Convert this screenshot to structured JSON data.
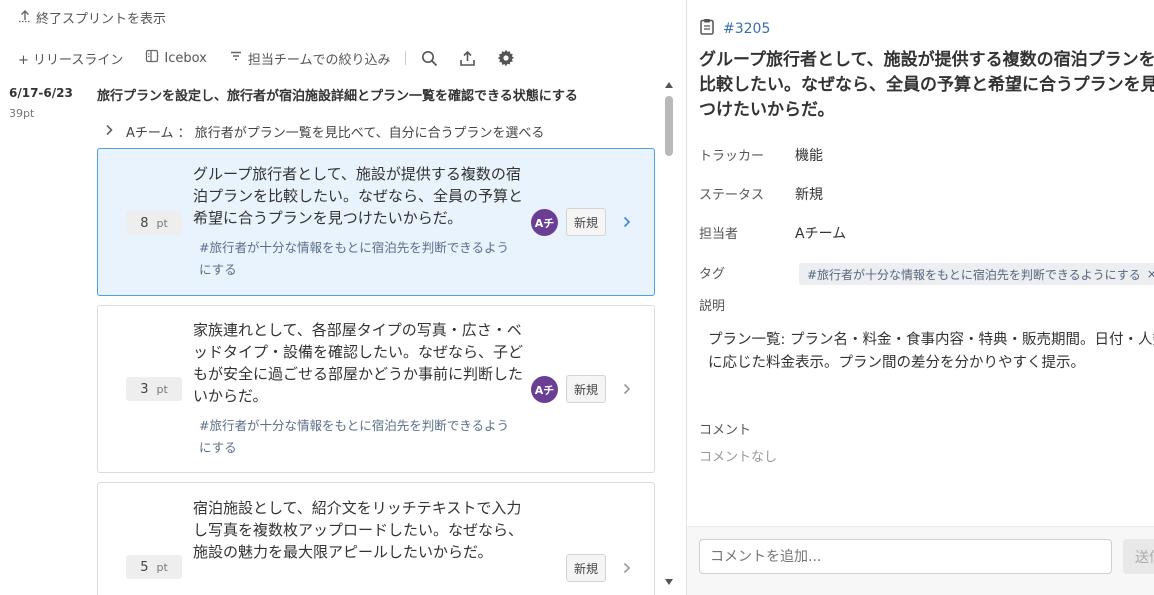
{
  "left": {
    "show_ended_label": "終了スプリントを表示",
    "toolbar": {
      "release_line": "+ リリースライン",
      "icebox": "Icebox",
      "filter": "担当チームでの絞り込み"
    },
    "sprint": {
      "date": "6/17-6/23",
      "points": "39pt",
      "title": "旅行プランを設定し、旅行者が宿泊施設詳細とプラン一覧を確認できる状態にする"
    },
    "team_group": {
      "label": "Aチーム ： 旅行者がプラン一覧を見比べて、自分に合うプランを選べる"
    },
    "cards": [
      {
        "points": "8",
        "unit": "pt",
        "description": "グループ旅行者として、施設が提供する複数の宿泊プランを比較したい。なぜなら、全員の予算と希望に合うプランを見つけたいからだ。",
        "tag": "#旅行者が十分な情報をもとに宿泊先を判断できるようにする",
        "avatar": "Aチ",
        "status": "新規"
      },
      {
        "points": "3",
        "unit": "pt",
        "description": "家族連れとして、各部屋タイプの写真・広さ・ベッドタイプ・設備を確認したい。なぜなら、子どもが安全に過ごせる部屋かどうか事前に判断したいからだ。",
        "tag": "#旅行者が十分な情報をもとに宿泊先を判断できるようにする",
        "avatar": "Aチ",
        "status": "新規"
      },
      {
        "points": "5",
        "unit": "pt",
        "description": "宿泊施設として、紹介文をリッチテキストで入力し写真を複数枚アップロードしたい。なぜなら、施設の魅力を最大限アピールしたいからだ。",
        "status": "新規"
      }
    ]
  },
  "detail": {
    "issue_id": "#3205",
    "title": "グループ旅行者として、施設が提供する複数の宿泊プランを比較したい。なぜなら、全員の予算と希望に合うプランを見つけたいからだ。",
    "fields": {
      "tracker_label": "トラッカー",
      "tracker_value": "機能",
      "status_label": "ステータス",
      "status_value": "新規",
      "assignee_label": "担当者",
      "assignee_value": "Aチーム",
      "tag_label": "タグ",
      "tag_value": "#旅行者が十分な情報をもとに宿泊先を判断できるようにする",
      "tag_remove": "×",
      "description_label": "説明"
    },
    "description": "プラン一覧: プラン名・料金・食事内容・特典・販売期間。日付・人数に応じた料金表示。プラン間の差分を分かりやすく提示。",
    "comments_label": "コメント",
    "no_comments": "コメントなし",
    "comment_placeholder": "コメントを追加...",
    "send_label": "送信"
  }
}
